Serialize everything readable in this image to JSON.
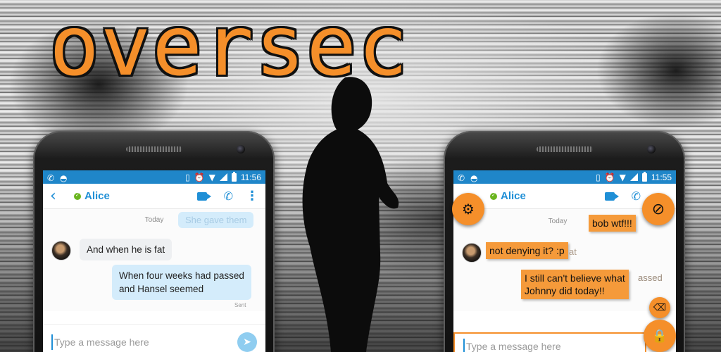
{
  "branding": {
    "logo_text": "oversec"
  },
  "colors": {
    "accent": "#f58f2a",
    "skype_blue": "#1f8fd6",
    "statusbar": "#1f86c9"
  },
  "left_phone": {
    "status_time": "11:56",
    "contact_name": "Alice",
    "day_label": "Today",
    "ghost_text": "She gave them",
    "incoming_message": "And when he is fat",
    "outgoing_line1": "When four weeks had passed",
    "outgoing_line2": "and Hansel seemed",
    "sent_label": "Sent",
    "composer_placeholder": "Type a message here"
  },
  "right_phone": {
    "status_time": "11:55",
    "contact_name": "Alice",
    "day_label": "Today",
    "decrypted_msg_1": "bob wtf!!!",
    "decrypted_msg_2": "not denying it? :p",
    "ghost_short": "at",
    "decrypted_msg_3_line1": "I still can't believe what",
    "decrypted_msg_3_line2": "Johnny did today!!",
    "ghost_passed": "assed",
    "composer_placeholder": "Type a message here"
  }
}
